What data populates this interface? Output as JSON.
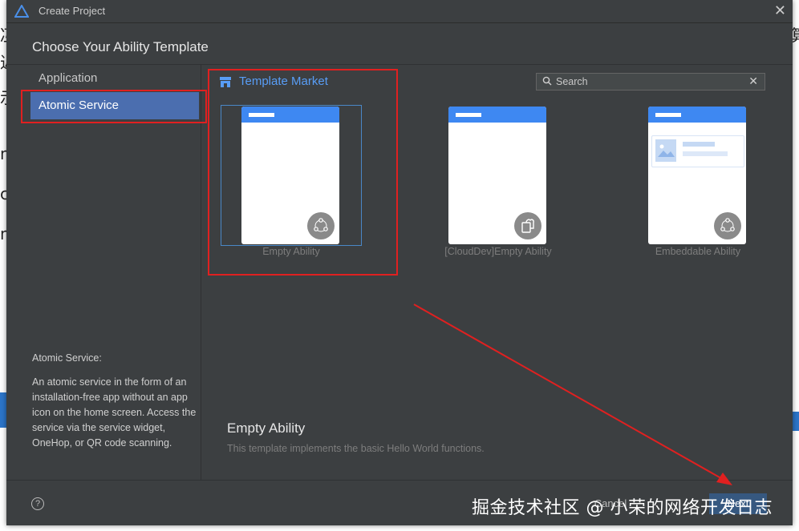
{
  "window": {
    "title": "Create Project",
    "heading": "Choose Your Ability Template",
    "close_icon": "close-icon"
  },
  "sidebar": {
    "items": [
      {
        "label": "Application",
        "active": false
      },
      {
        "label": "Atomic Service",
        "active": true
      }
    ],
    "description_title": "Atomic Service:",
    "description": "An atomic service in the form of an installation-free app without an app icon on the home screen. Access the service via the service widget, OneHop, or QR code scanning."
  },
  "main": {
    "template_market": "Template Market",
    "search": {
      "placeholder": "Search",
      "value": ""
    },
    "templates": [
      {
        "name": "Empty Ability",
        "selected": true,
        "badge_icon": "share-nodes-icon"
      },
      {
        "name": "[CloudDev]Empty Ability",
        "selected": false,
        "badge_icon": "cloud-doc-icon"
      },
      {
        "name": "Embeddable Ability",
        "selected": false,
        "badge_icon": "share-nodes-icon"
      }
    ],
    "detail": {
      "title": "Empty Ability",
      "description": "This template implements the basic Hello World functions."
    }
  },
  "footer": {
    "help": "?",
    "cancel_label": "Cancel",
    "next_label": "Next"
  },
  "watermark": "掘金技术社区 @ 小荣的网络开发日志",
  "colors": {
    "dialog_bg": "#3c3f41",
    "active_item": "#4b6eaf",
    "accent": "#589df6",
    "phone_header": "#3e88f2",
    "annotation": "#e02020"
  }
}
